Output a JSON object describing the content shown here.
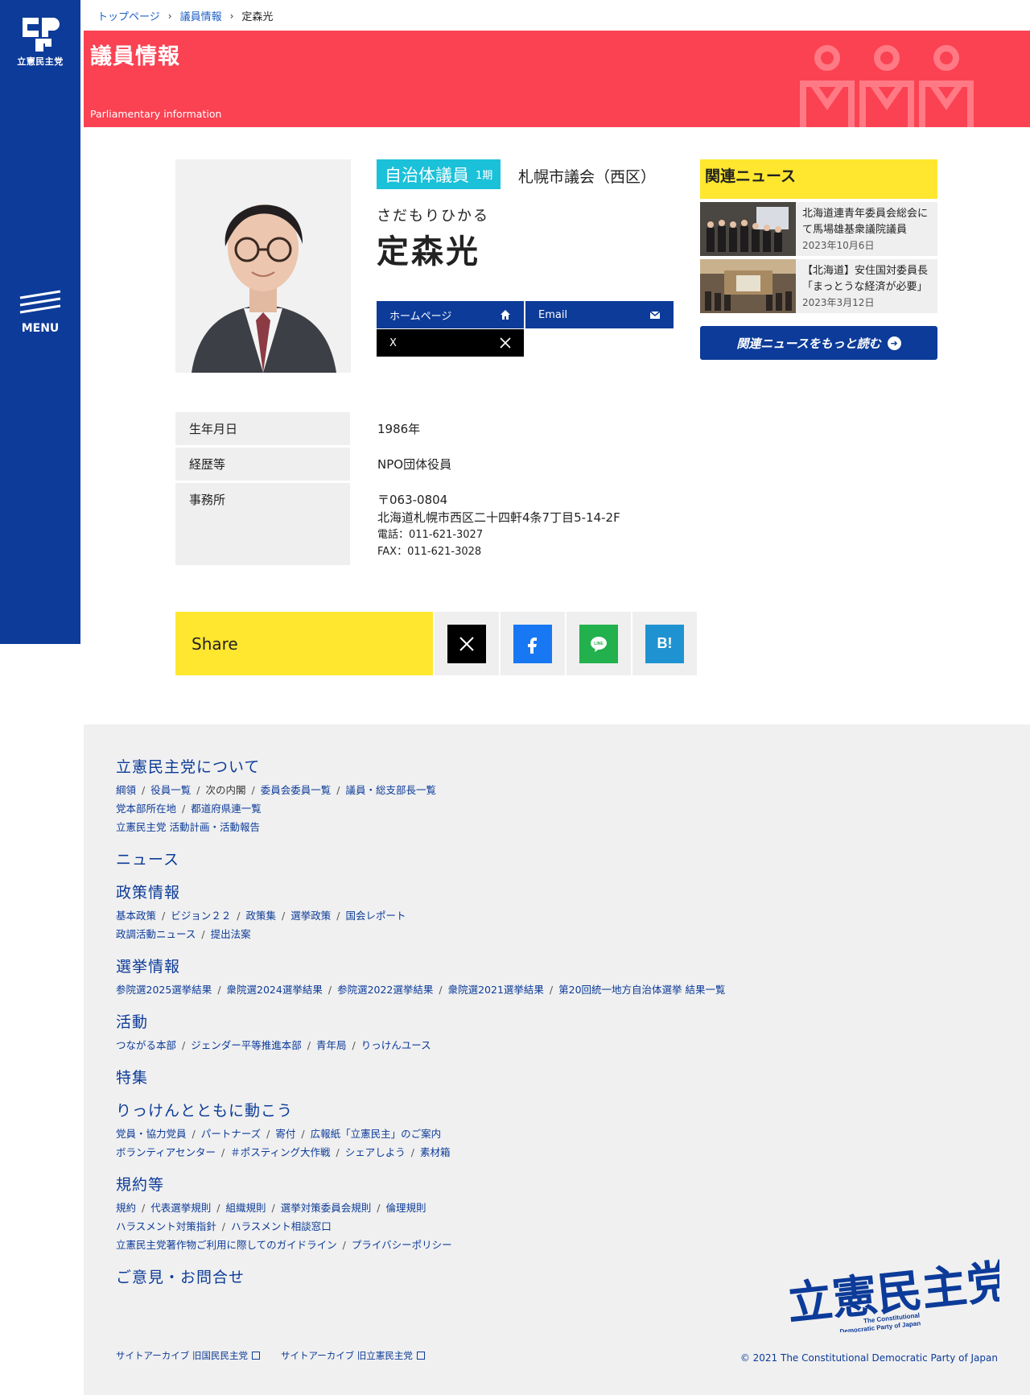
{
  "sidebar": {
    "logo_text": "立憲民主党",
    "menu_label": "MENU"
  },
  "breadcrumb": {
    "top": "トップページ",
    "members": "議員情報",
    "current": "定森光"
  },
  "banner": {
    "title": "議員情報",
    "subtitle": "Parliamentary information"
  },
  "member": {
    "badge": "自治体議員",
    "term": "1期",
    "assembly": "札幌市議会（西区）",
    "kana": "さだもりひかる",
    "name": "定森光"
  },
  "links": {
    "homepage": "ホームページ",
    "email": "Email",
    "x": "X"
  },
  "news": {
    "heading": "関連ニュース",
    "items": [
      {
        "title": "北海道連青年委員会総会にて馬場雄基衆議院議員",
        "date": "2023年10月6日"
      },
      {
        "title": "【北海道】安住国対委員長「まっとうな経済が必要」",
        "date": "2023年3月12日"
      }
    ],
    "more": "関連ニュースをもっと読む"
  },
  "profile": {
    "birth_label": "生年月日",
    "birth_value": "1986年",
    "career_label": "経歴等",
    "career_value": "NPO団体役員",
    "office_label": "事務所",
    "office_zip": "〒063-0804",
    "office_address": "北海道札幌市西区二十四軒4条7丁目5-14-2F",
    "office_tel": "電話：011-621-3027",
    "office_fax": "FAX：011-621-3028"
  },
  "share": {
    "label": "Share",
    "line_text": "LINE",
    "hatena_text": "B!"
  },
  "footer": {
    "sections": [
      {
        "heading": "立憲民主党について",
        "rows": [
          [
            "綱領",
            "役員一覧",
            "次の内閣",
            "委員会委員一覧",
            "議員・総支部長一覧"
          ],
          [
            "党本部所在地",
            "都道府県連一覧"
          ],
          [
            "立憲民主党 活動計画・活動報告"
          ]
        ]
      },
      {
        "heading": "ニュース",
        "rows": []
      },
      {
        "heading": "政策情報",
        "rows": [
          [
            "基本政策",
            "ビジョン２２",
            "政策集",
            "選挙政策",
            "国会レポート"
          ],
          [
            "政調活動ニュース",
            "提出法案"
          ]
        ]
      },
      {
        "heading": "選挙情報",
        "rows": [
          [
            "参院選2025選挙結果",
            "衆院選2024選挙結果",
            "参院選2022選挙結果",
            "衆院選2021選挙結果",
            "第20回統一地方自治体選挙 結果一覧"
          ]
        ]
      },
      {
        "heading": "活動",
        "rows": [
          [
            "つながる本部",
            "ジェンダー平等推進本部",
            "青年局",
            "りっけんユース"
          ]
        ]
      },
      {
        "heading": "特集",
        "rows": []
      },
      {
        "heading": "りっけんとともに動こう",
        "rows": [
          [
            "党員・協力党員",
            "パートナーズ",
            "寄付",
            "広報紙「立憲民主」のご案内"
          ],
          [
            "ボランティアセンター",
            "＃ポスティング大作戦",
            "シェアしよう",
            "素材箱"
          ]
        ]
      },
      {
        "heading": "規約等",
        "rows": [
          [
            "規約",
            "代表選挙規則",
            "組織規則",
            "選挙対策委員会規則",
            "倫理規則"
          ],
          [
            "ハラスメント対策指針",
            "ハラスメント相談窓口"
          ],
          [
            "立憲民主党著作物ご利用に際してのガイドライン",
            "プライバシーポリシー"
          ]
        ]
      },
      {
        "heading": "ご意見・お問合せ",
        "rows": []
      }
    ],
    "archive_1": "サイトアーカイブ 旧国民民主党",
    "archive_2": "サイトアーカイブ 旧立憲民主党",
    "logo_text": "立憲民主党",
    "logo_en_1": "The Constitutional",
    "logo_en_2": "Democratic Party of Japan",
    "copyright": "© 2021 The Constitutional Democratic Party of Japan"
  },
  "colors": {
    "brand_blue": "#0c3b99",
    "banner_red": "#fa4252",
    "badge_cyan": "#1bc1d9",
    "accent_yellow": "#ffe72f"
  }
}
